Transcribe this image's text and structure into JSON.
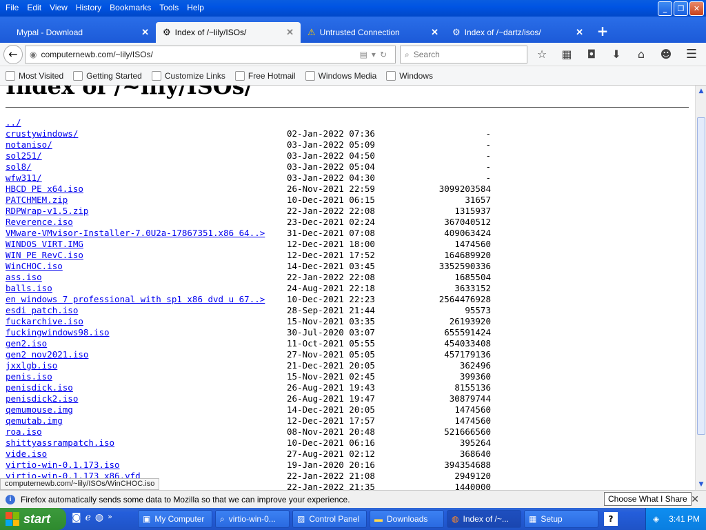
{
  "menu": [
    "File",
    "Edit",
    "View",
    "History",
    "Bookmarks",
    "Tools",
    "Help"
  ],
  "tabs": [
    {
      "label": "Mypal - Download"
    },
    {
      "label": "Index of /~lily/ISOs/"
    },
    {
      "label": "Untrusted Connection"
    },
    {
      "label": "Index of /~dartz/isos/"
    }
  ],
  "nav": {
    "url": "computernewb.com/~lily/ISOs/",
    "search_placeholder": "Search"
  },
  "bookmarks": [
    "Most Visited",
    "Getting Started",
    "Customize Links",
    "Free Hotmail",
    "Windows Media",
    "Windows"
  ],
  "page": {
    "title": "Index of /~lily/ISOs/",
    "files": [
      {
        "name": "../",
        "date": "",
        "size": ""
      },
      {
        "name": "crustywindows/",
        "date": "02-Jan-2022 07:36",
        "size": "-"
      },
      {
        "name": "notaniso/",
        "date": "03-Jan-2022 05:09",
        "size": "-"
      },
      {
        "name": "sol251/",
        "date": "03-Jan-2022 04:50",
        "size": "-"
      },
      {
        "name": "sol8/",
        "date": "03-Jan-2022 05:04",
        "size": "-"
      },
      {
        "name": "wfw311/",
        "date": "03-Jan-2022 04:30",
        "size": "-"
      },
      {
        "name": "HBCD PE x64.iso",
        "date": "26-Nov-2021 22:59",
        "size": "3099203584"
      },
      {
        "name": "PATCHMEM.zip",
        "date": "10-Dec-2021 06:15",
        "size": "31657"
      },
      {
        "name": "RDPWrap-v1.5.zip",
        "date": "22-Jan-2022 22:08",
        "size": "1315937"
      },
      {
        "name": "Reverence.iso",
        "date": "23-Dec-2021 02:24",
        "size": "367040512"
      },
      {
        "name": "VMware-VMvisor-Installer-7.0U2a-17867351.x86 64..>",
        "date": "31-Dec-2021 07:08",
        "size": "409063424"
      },
      {
        "name": "WINDOS VIRT.IMG",
        "date": "12-Dec-2021 18:00",
        "size": "1474560"
      },
      {
        "name": "WIN PE RevC.iso",
        "date": "12-Dec-2021 17:52",
        "size": "164689920"
      },
      {
        "name": "WinCHOC.iso",
        "date": "14-Dec-2021 03:45",
        "size": "3352590336"
      },
      {
        "name": "ass.iso",
        "date": "22-Jan-2022 22:08",
        "size": "1685504"
      },
      {
        "name": "balls.iso",
        "date": "24-Aug-2021 22:18",
        "size": "3633152"
      },
      {
        "name": "en windows 7 professional with sp1 x86 dvd u 67..>",
        "date": "10-Dec-2021 22:23",
        "size": "2564476928"
      },
      {
        "name": "esdi patch.iso",
        "date": "28-Sep-2021 21:44",
        "size": "95573"
      },
      {
        "name": "fuckarchive.iso",
        "date": "15-Nov-2021 03:35",
        "size": "26193920"
      },
      {
        "name": "fuckingwindows98.iso",
        "date": "30-Jul-2020 03:07",
        "size": "655591424"
      },
      {
        "name": "gen2.iso",
        "date": "11-Oct-2021 05:55",
        "size": "454033408"
      },
      {
        "name": "gen2 nov2021.iso",
        "date": "27-Nov-2021 05:05",
        "size": "457179136"
      },
      {
        "name": "jxxlgb.iso",
        "date": "21-Dec-2021 20:05",
        "size": "362496"
      },
      {
        "name": "penis.iso",
        "date": "15-Nov-2021 02:45",
        "size": "399360"
      },
      {
        "name": "penisdick.iso",
        "date": "26-Aug-2021 19:43",
        "size": "8155136"
      },
      {
        "name": "penisdick2.iso",
        "date": "26-Aug-2021 19:47",
        "size": "30879744"
      },
      {
        "name": "qemumouse.img",
        "date": "14-Dec-2021 20:05",
        "size": "1474560"
      },
      {
        "name": "qemutab.img",
        "date": "12-Dec-2021 17:57",
        "size": "1474560"
      },
      {
        "name": "roa.iso",
        "date": "08-Nov-2021 20:48",
        "size": "521666560"
      },
      {
        "name": "shittyassrampatch.iso",
        "date": "10-Dec-2021 06:16",
        "size": "395264"
      },
      {
        "name": "vide.iso",
        "date": "27-Aug-2021 02:12",
        "size": "368640"
      },
      {
        "name": "virtio-win-0.1.173.iso",
        "date": "19-Jan-2020 20:16",
        "size": "394354688"
      },
      {
        "name": "virtio-win-0.1.173 x86.vfd",
        "date": "22-Jan-2022 21:08",
        "size": "2949120"
      },
      {
        "name": "",
        "date": "22-Jan-2022 21:35",
        "size": "1440000"
      }
    ]
  },
  "status_url": "computernewb.com/~lily/ISOs/WinCHOC.iso",
  "notification": {
    "text": "Firefox automatically sends some data to Mozilla so that we can improve your experience.",
    "button": "Choose What I Share"
  },
  "taskbar": {
    "start": "start",
    "tasks": [
      "My Computer",
      "virtio-win-0...",
      "Control Panel",
      "Downloads",
      "Index of /~...",
      "Setup"
    ],
    "clock": "3:41 PM"
  }
}
